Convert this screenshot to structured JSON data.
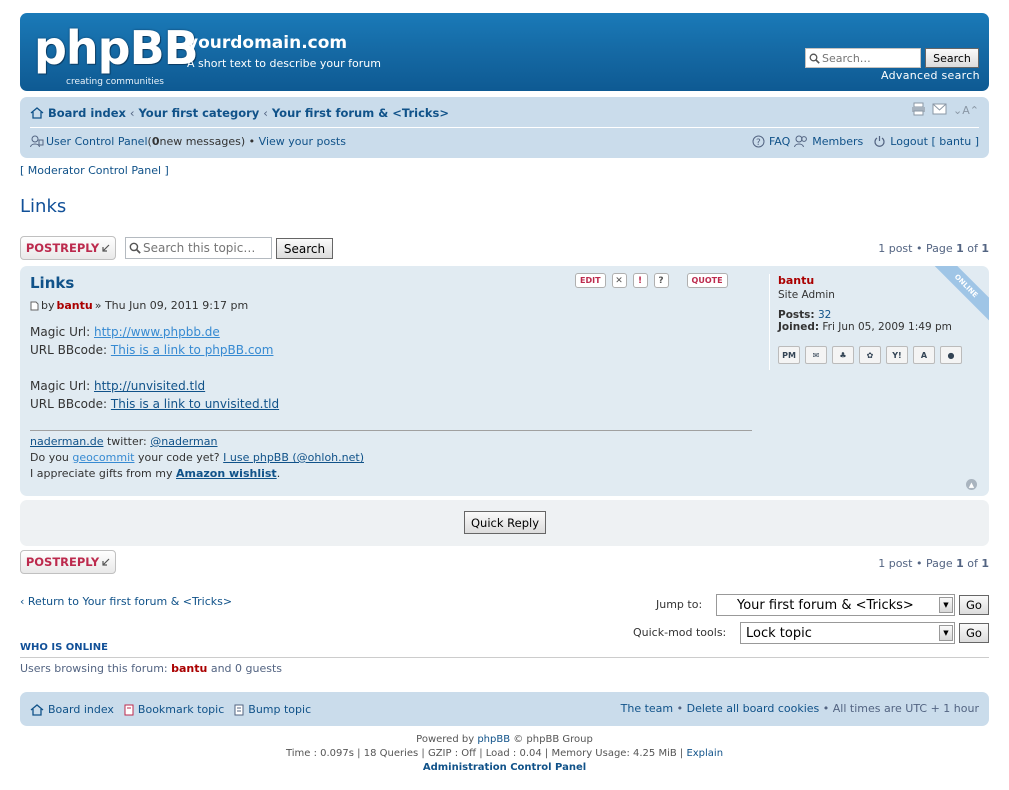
{
  "header": {
    "logo_text": "phpBB",
    "logo_sub": "creating communities",
    "site_title": "yourdomain.com",
    "site_desc": "A short text to describe your forum",
    "search_placeholder": "Search…",
    "search_button": "Search",
    "advanced_search": "Advanced search"
  },
  "navbar": {
    "breadcrumbs": [
      "Board index",
      "Your first category",
      "Your first forum & <Tricks>"
    ],
    "ucp": "User Control Panel",
    "ucp_open": " (",
    "new_messages_count": "0",
    "new_messages_suffix": " new messages)",
    "bullet": " • ",
    "view_posts": "View your posts",
    "faq": "FAQ",
    "members": "Members",
    "logout": "Logout [ bantu ]",
    "font_change": "A"
  },
  "mcp": "[ Moderator Control Panel ]",
  "page_title": "Links",
  "actions": {
    "postreply": "POSTREPLY",
    "topic_search_placeholder": "Search this topic…",
    "search_button": "Search",
    "pagination_top": [
      "1 post • Page ",
      "1",
      " of ",
      "1"
    ],
    "pagination_bottom": [
      "1 post • Page ",
      "1",
      " of ",
      "1"
    ]
  },
  "post": {
    "title": "Links",
    "buttons": {
      "edit": "EDIT",
      "quote": "QUOTE"
    },
    "by": "by",
    "author": "bantu",
    "date": " » Thu Jun 09, 2011 9:17 pm",
    "lines": [
      {
        "label": "Magic Url: ",
        "link": "http://www.phpbb.de"
      },
      {
        "label": "URL BBcode: ",
        "link": "This is a link to phpBB.com"
      },
      {
        "label": "Magic Url: ",
        "link": "http://unvisited.tld"
      },
      {
        "label": "URL BBcode: ",
        "link": "This is a link to unvisited.tld"
      }
    ],
    "sig": {
      "l1_link": "naderman.de",
      "l1_mid": " twitter: ",
      "l1_link2": "@naderman",
      "l2_pre": "Do you ",
      "l2_link": "geocommit",
      "l2_mid": " your code yet? ",
      "l2_link2": "I use phpBB (@ohloh.net)",
      "l3_pre": "I appreciate gifts from my ",
      "l3_link": "Amazon wishlist",
      "l3_post": "."
    },
    "profile": {
      "name": "bantu",
      "rank": "Site Admin",
      "posts_label": "Posts:",
      "posts": " 32",
      "joined_label": "Joined:",
      "joined": " Fri Jun 05, 2009 1:49 pm",
      "online": "ONLINE"
    }
  },
  "quick_reply": "Quick Reply",
  "bottom": {
    "return": "Return to Your first forum & <Tricks>",
    "jump_label": "Jump to:",
    "jump_value": "Your first forum & <Tricks>",
    "qm_label": "Quick-mod tools:",
    "qm_value": "Lock topic",
    "go": "Go"
  },
  "who": {
    "heading": "WHO IS ONLINE",
    "pre": "Users browsing this forum: ",
    "user": "bantu",
    "post": " and 0 guests"
  },
  "footer": {
    "board_index": "Board index",
    "bookmark": "Bookmark topic",
    "bump": "Bump topic",
    "team": "The team",
    "delete_cookies": "Delete all board cookies",
    "times": "All times are UTC + 1 hour",
    "powered_pre": "Powered by ",
    "powered_link": "phpBB",
    "powered_post": " © phpBB Group",
    "debug": "Time : 0.097s | 18 Queries | GZIP : Off | Load : 0.04 | Memory Usage: 4.25 MiB | ",
    "explain": "Explain",
    "acp": "Administration Control Panel"
  },
  "colors": {
    "header_blue": "#1569a4",
    "navbar": "#cadceb",
    "post_bg": "#e1ebf2",
    "postreply_red": "#bc2a4d",
    "username_red": "#aa0000",
    "link_blue": "#105289"
  }
}
